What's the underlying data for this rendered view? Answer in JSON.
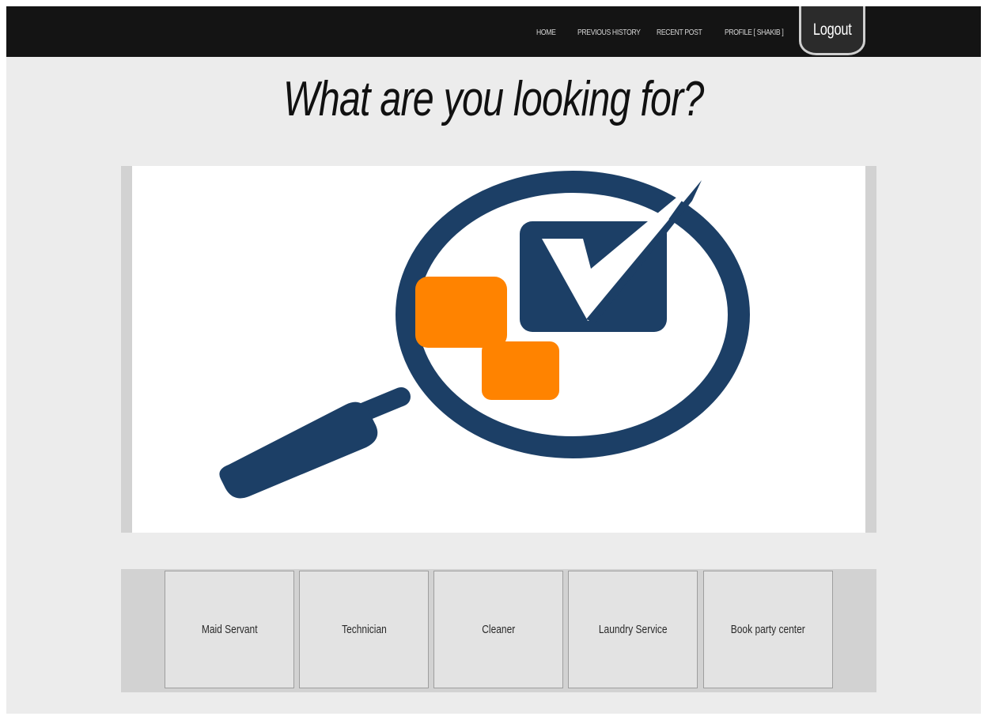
{
  "nav": {
    "home": "HOME",
    "previous_history": "PREVIOUS HISTORY",
    "recent_post": "RECENT POST",
    "profile": "PROFILE [ SHAKIB ]",
    "logout": "Logout"
  },
  "headline": "What are you looking for?",
  "banner": {
    "icon": "magnifier-check-icon",
    "colors": {
      "navy": "#1c3f66",
      "orange": "#ff8300"
    }
  },
  "categories": [
    {
      "label": "Maid Servant"
    },
    {
      "label": "Technician"
    },
    {
      "label": "Cleaner"
    },
    {
      "label": "Laundry Service"
    },
    {
      "label": "Book party center"
    }
  ],
  "colors": {
    "navbar_bg": "#141414",
    "page_bg": "#ececec"
  }
}
